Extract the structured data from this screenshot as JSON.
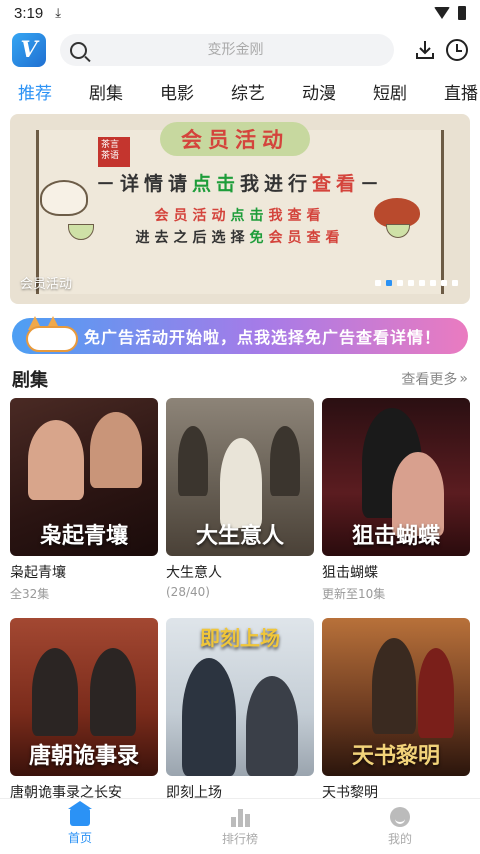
{
  "status_bar": {
    "time": "3:19",
    "download_icon": "download-arrow-icon"
  },
  "header": {
    "logo_letter": "V",
    "search_placeholder": "变形金刚",
    "icons": [
      "search-icon",
      "download-icon",
      "history-clock-icon"
    ]
  },
  "tabs": [
    {
      "label": "推荐",
      "active": true
    },
    {
      "label": "剧集"
    },
    {
      "label": "电影"
    },
    {
      "label": "综艺"
    },
    {
      "label": "动漫"
    },
    {
      "label": "短剧"
    },
    {
      "label": "直播"
    }
  ],
  "banner": {
    "seal_text": "茶言茶语",
    "title": "会员活动",
    "line1_a": "－详情请",
    "line1_b": "点击",
    "line1_c": "我进行",
    "line1_d": "查看",
    "line1_e": "－",
    "line2_a": "会员活动",
    "line2_b": "点击",
    "line2_c": "我查看",
    "line3_a": "进去之后选择",
    "line3_b": "免",
    "line3_c": "会员",
    "line3_d": "查看",
    "caption": "会员活动",
    "dot_count": 8,
    "active_dot": 2
  },
  "promo": {
    "text": "免广告活动开始啦，点我选择免广告查看详情！"
  },
  "section": {
    "title": "剧集",
    "more": "查看更多"
  },
  "cards": [
    {
      "name": "枭起青壤",
      "sub": "全32集",
      "overlay": "枭起青壤"
    },
    {
      "name": "大生意人",
      "sub": "(28/40)",
      "overlay": "大生意人"
    },
    {
      "name": "狙击蝴蝶",
      "sub": "更新至10集",
      "overlay": "狙击蝴蝶"
    },
    {
      "name": "唐朝诡事录之长安",
      "sub": "",
      "overlay": "唐朝诡事录"
    },
    {
      "name": "即刻上场",
      "sub": "",
      "overlay": "即刻上场"
    },
    {
      "name": "天书黎明",
      "sub": "",
      "overlay": "天书黎明"
    }
  ],
  "bottom_nav": [
    {
      "label": "首页",
      "active": true,
      "icon": "home-icon"
    },
    {
      "label": "排行榜",
      "icon": "ranking-icon"
    },
    {
      "label": "我的",
      "icon": "profile-icon"
    }
  ],
  "colors": {
    "accent": "#2b92f5"
  }
}
